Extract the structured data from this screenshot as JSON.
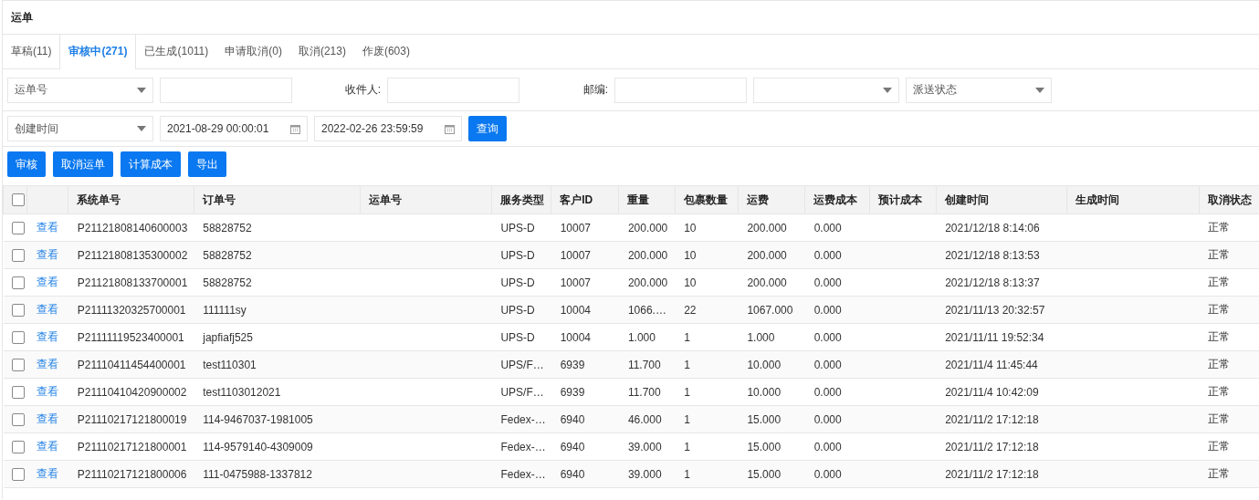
{
  "title": "运单",
  "tabs": [
    {
      "label": "草稿(11)",
      "selected": false
    },
    {
      "label": "审核中(271)",
      "selected": true
    },
    {
      "label": "已生成(1011)",
      "selected": false
    },
    {
      "label": "申请取消(0)",
      "selected": false
    },
    {
      "label": "取消(213)",
      "selected": false
    },
    {
      "label": "作废(603)",
      "selected": false
    }
  ],
  "filters": [
    [
      {
        "kind": "select",
        "value": "运单号"
      },
      {
        "kind": "input"
      },
      {
        "kind": "label",
        "text": "收件人:"
      },
      {
        "kind": "input"
      },
      {
        "kind": "label",
        "text": "邮编:"
      },
      {
        "kind": "input"
      },
      {
        "kind": "select"
      },
      {
        "kind": "select",
        "value": "派送状态"
      }
    ],
    [
      {
        "kind": "select",
        "value": "创建时间"
      },
      {
        "kind": "date",
        "value": "2021-08-29 00:00:01"
      },
      {
        "kind": "date",
        "value": "2022-02-26 23:59:59"
      },
      {
        "kind": "button",
        "text": "查询"
      }
    ]
  ],
  "actions": [
    "审核",
    "取消运单",
    "计算成本",
    "导出"
  ],
  "table": {
    "all_checked": false,
    "columns": [
      "系统单号",
      "订单号",
      "运单号",
      "服务类型",
      "客户ID",
      "重量",
      "包裹数量",
      "运费",
      "运费成本",
      "预计成本",
      "创建时间",
      "生成时间",
      "取消状态"
    ],
    "rows": [
      {
        "checked": false,
        "link": "查看",
        "cells": [
          "P21121808140600003",
          "58828752",
          null,
          "UPS-D",
          "10007",
          "200.000",
          "10",
          "200.000",
          "0.000",
          null,
          "2021/12/18 8:14:06",
          null,
          "正常"
        ]
      },
      {
        "checked": false,
        "link": "查看",
        "cells": [
          "P21121808135300002",
          "58828752",
          null,
          "UPS-D",
          "10007",
          "200.000",
          "10",
          "200.000",
          "0.000",
          null,
          "2021/12/18 8:13:53",
          null,
          "正常"
        ]
      },
      {
        "checked": false,
        "link": "查看",
        "cells": [
          "P21121808133700001",
          "58828752",
          null,
          "UPS-D",
          "10007",
          "200.000",
          "10",
          "200.000",
          "0.000",
          null,
          "2021/12/18 8:13:37",
          null,
          "正常"
        ]
      },
      {
        "checked": false,
        "link": "查看",
        "cells": [
          "P21111320325700001",
          "111111sy",
          null,
          "UPS-D",
          "10004",
          "1066.…",
          "22",
          "1067.000",
          "0.000",
          null,
          "2021/11/13 20:32:57",
          null,
          "正常"
        ]
      },
      {
        "checked": false,
        "link": "查看",
        "cells": [
          "P21111119523400001",
          "japfiafj525",
          null,
          "UPS-D",
          "10004",
          "1.000",
          "1",
          "1.000",
          "0.000",
          null,
          "2021/11/11 19:52:34",
          null,
          "正常"
        ]
      },
      {
        "checked": false,
        "link": "查看",
        "cells": [
          "P21110411454400001",
          "test110301",
          null,
          "UPS/F…",
          "6939",
          "11.700",
          "1",
          "10.000",
          "0.000",
          null,
          "2021/11/4 11:45:44",
          null,
          "正常"
        ]
      },
      {
        "checked": false,
        "link": "查看",
        "cells": [
          "P21110410420900002",
          "test1103012021",
          null,
          "UPS/F…",
          "6939",
          "11.700",
          "1",
          "10.000",
          "0.000",
          null,
          "2021/11/4 10:42:09",
          null,
          "正常"
        ]
      },
      {
        "checked": false,
        "link": "查看",
        "cells": [
          "P21110217121800019",
          "114-9467037-1981005",
          null,
          "Fedex-…",
          "6940",
          "46.000",
          "1",
          "15.000",
          "0.000",
          null,
          "2021/11/2 17:12:18",
          null,
          "正常"
        ]
      },
      {
        "checked": false,
        "link": "查看",
        "cells": [
          "P21110217121800001",
          "114-9579140-4309009",
          null,
          "Fedex-…",
          "6940",
          "39.000",
          "1",
          "15.000",
          "0.000",
          null,
          "2021/11/2 17:12:18",
          null,
          "正常"
        ]
      },
      {
        "checked": false,
        "link": "查看",
        "cells": [
          "P21110217121800006",
          "111-0475988-1337812",
          null,
          "Fedex-…",
          "6940",
          "39.000",
          "1",
          "15.000",
          "0.000",
          null,
          "2021/11/2 17:12:18",
          null,
          "正常"
        ]
      }
    ]
  }
}
